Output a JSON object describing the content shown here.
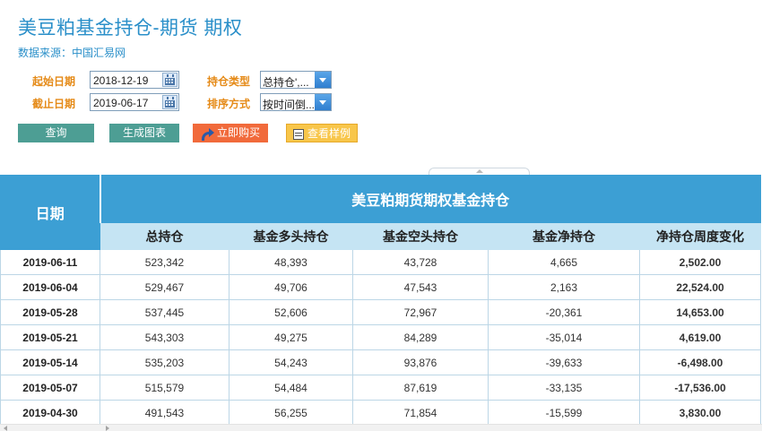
{
  "header": {
    "title": "美豆粕基金持仓-期货 期权",
    "source": "数据来源：中国汇易网"
  },
  "filters": {
    "start_label": "起始日期",
    "start_value": "2018-12-19",
    "end_label": "截止日期",
    "end_value": "2019-06-17",
    "position_type_label": "持仓类型",
    "position_type_value": "总持仓',...",
    "sort_label": "排序方式",
    "sort_value": "按时间倒..."
  },
  "buttons": {
    "query": "查询",
    "chart": "生成图表",
    "buy": "立即购买",
    "sample": "查看样例"
  },
  "table": {
    "date_header": "日期",
    "group_header": "美豆粕期货期权基金持仓",
    "columns": [
      "总持仓",
      "基金多头持仓",
      "基金空头持仓",
      "基金净持仓",
      "净持仓周度变化"
    ],
    "rows": [
      {
        "date": "2019-06-11",
        "total": "523,342",
        "long": "48,393",
        "short": "43,728",
        "net": "4,665",
        "change": "2,502.00"
      },
      {
        "date": "2019-06-04",
        "total": "529,467",
        "long": "49,706",
        "short": "47,543",
        "net": "2,163",
        "change": "22,524.00"
      },
      {
        "date": "2019-05-28",
        "total": "537,445",
        "long": "52,606",
        "short": "72,967",
        "net": "-20,361",
        "change": "14,653.00"
      },
      {
        "date": "2019-05-21",
        "total": "543,303",
        "long": "49,275",
        "short": "84,289",
        "net": "-35,014",
        "change": "4,619.00"
      },
      {
        "date": "2019-05-14",
        "total": "535,203",
        "long": "54,243",
        "short": "93,876",
        "net": "-39,633",
        "change": "-6,498.00"
      },
      {
        "date": "2019-05-07",
        "total": "515,579",
        "long": "54,484",
        "short": "87,619",
        "net": "-33,135",
        "change": "-17,536.00"
      },
      {
        "date": "2019-04-30",
        "total": "491,543",
        "long": "56,255",
        "short": "71,854",
        "net": "-15,599",
        "change": "3,830.00"
      }
    ]
  },
  "colors": {
    "accent": "#2a8fc9",
    "header_bg": "#3c9fd4",
    "subheader_bg": "#c5e4f3",
    "positive": "#e02020",
    "negative": "#3b9c3b",
    "label_orange": "#e58a17"
  },
  "icons": {
    "date_picker": "calendar-icon",
    "dropdown": "chevron-down-icon",
    "buy": "share-arrow-icon",
    "sample": "document-icon"
  }
}
